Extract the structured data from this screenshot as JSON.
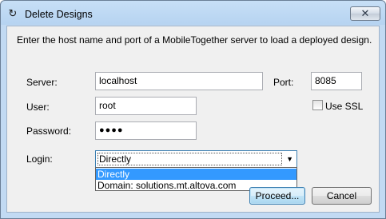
{
  "window": {
    "title": "Delete Designs",
    "close_label": "✕"
  },
  "intro_text": "Enter the host name and port of a MobileTogether server to load a deployed design.",
  "form": {
    "server_label": "Server:",
    "server_value": "localhost",
    "port_label": "Port:",
    "port_value": "8085",
    "user_label": "User:",
    "user_value": "root",
    "use_ssl_label": "Use SSL",
    "use_ssl_checked": false,
    "password_label": "Password:",
    "password_value": "●●●●",
    "login_label": "Login:",
    "login_value": "Directly",
    "login_options": [
      "Directly",
      "Domain: solutions.mt.altova.com"
    ]
  },
  "buttons": {
    "proceed_label": "Proceed...",
    "cancel_label": "Cancel"
  },
  "icons": {
    "title_icon": "refresh-arrows-icon",
    "dropdown_arrow": "chevron-down-icon"
  }
}
